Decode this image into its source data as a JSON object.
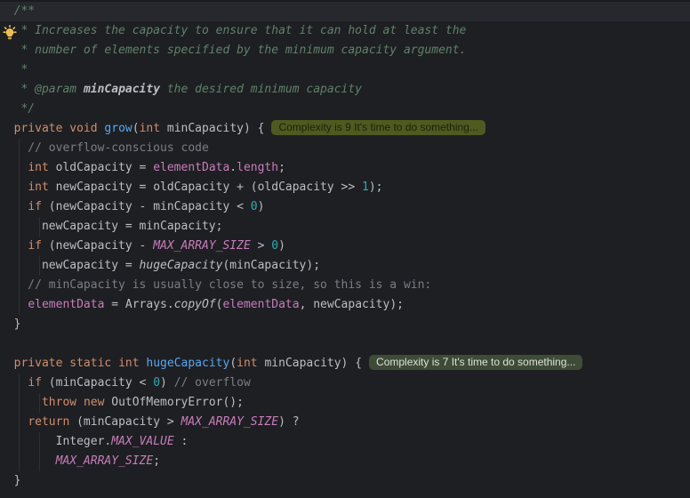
{
  "app": {
    "kind": "code-editor",
    "language": "java",
    "background": "#1e1f22",
    "caret_line_color": "#26282e",
    "indent_guide_color": "#2e3035"
  },
  "syntax_colors": {
    "doc_comment": "#5f826b",
    "line_comment": "#7a7e85",
    "keyword": "#cf8e6d",
    "method_declaration": "#56a8f5",
    "static_call": "#bcbec4",
    "field": "#c77dbb",
    "static_constant": "#c77dbb",
    "number": "#2aacb8",
    "plain_text": "#bcbec4"
  },
  "icons": {
    "intention_bulb": "lightbulb-icon",
    "bulb_color": "#edc04d"
  },
  "hints": {
    "grow": {
      "label": "Complexity is 9 It's time to do something...",
      "bg": "#4e5a20",
      "fg": "#1a220a"
    },
    "hugeCapacity": {
      "label": "Complexity is 7 It's time to do something...",
      "bg": "#3e4b37",
      "fg": "#dce2d6"
    }
  },
  "code": {
    "lines": [
      {
        "caret": true,
        "segments": [
          [
            "doc",
            "  /**"
          ]
        ]
      },
      {
        "bulb": true,
        "segments": [
          [
            "doc",
            "   * Increases the capacity to ensure that it can hold at least the"
          ]
        ]
      },
      {
        "segments": [
          [
            "doc",
            "   * number of elements specified by the minimum capacity argument."
          ]
        ]
      },
      {
        "segments": [
          [
            "doc",
            "   *"
          ]
        ]
      },
      {
        "segments": [
          [
            "doc",
            "   * "
          ],
          [
            "doctag",
            "@param"
          ],
          [
            "doc",
            " "
          ],
          [
            "docparam",
            "minCapacity"
          ],
          [
            "doc",
            " the desired minimum capacity"
          ]
        ]
      },
      {
        "segments": [
          [
            "doc",
            "   */"
          ]
        ]
      },
      {
        "hint": "grow",
        "segments": [
          [
            "plain",
            "  "
          ],
          [
            "kw",
            "private"
          ],
          [
            "plain",
            " "
          ],
          [
            "kw",
            "void"
          ],
          [
            "plain",
            " "
          ],
          [
            "mdecl",
            "grow"
          ],
          [
            "plain",
            "("
          ],
          [
            "kw",
            "int"
          ],
          [
            "plain",
            " minCapacity) {"
          ]
        ]
      },
      {
        "segments": [
          [
            "comment",
            "    // overflow-conscious code"
          ]
        ]
      },
      {
        "segments": [
          [
            "plain",
            "    "
          ],
          [
            "kw",
            "int"
          ],
          [
            "plain",
            " oldCapacity = "
          ],
          [
            "field",
            "elementData"
          ],
          [
            "plain",
            "."
          ],
          [
            "field",
            "length"
          ],
          [
            "plain",
            ";"
          ]
        ]
      },
      {
        "segments": [
          [
            "plain",
            "    "
          ],
          [
            "kw",
            "int"
          ],
          [
            "plain",
            " newCapacity = oldCapacity + (oldCapacity >> "
          ],
          [
            "num",
            "1"
          ],
          [
            "plain",
            ");"
          ]
        ]
      },
      {
        "segments": [
          [
            "plain",
            "    "
          ],
          [
            "kw",
            "if"
          ],
          [
            "plain",
            " (newCapacity - minCapacity < "
          ],
          [
            "num",
            "0"
          ],
          [
            "plain",
            ")"
          ]
        ]
      },
      {
        "segments": [
          [
            "plain",
            "      newCapacity = minCapacity;"
          ]
        ]
      },
      {
        "segments": [
          [
            "plain",
            "    "
          ],
          [
            "kw",
            "if"
          ],
          [
            "plain",
            " (newCapacity - "
          ],
          [
            "const",
            "MAX_ARRAY_SIZE"
          ],
          [
            "plain",
            " > "
          ],
          [
            "num",
            "0"
          ],
          [
            "plain",
            ")"
          ]
        ]
      },
      {
        "segments": [
          [
            "plain",
            "      newCapacity = "
          ],
          [
            "call",
            "hugeCapacity"
          ],
          [
            "plain",
            "(minCapacity);"
          ]
        ]
      },
      {
        "segments": [
          [
            "comment",
            "    // minCapacity is usually close to size, so this is a win:"
          ]
        ]
      },
      {
        "segments": [
          [
            "plain",
            "    "
          ],
          [
            "field",
            "elementData"
          ],
          [
            "plain",
            " = Arrays."
          ],
          [
            "call",
            "copyOf"
          ],
          [
            "plain",
            "("
          ],
          [
            "field",
            "elementData"
          ],
          [
            "plain",
            ", newCapacity);"
          ]
        ]
      },
      {
        "segments": [
          [
            "plain",
            "  }"
          ]
        ]
      },
      {
        "segments": [
          [
            "plain",
            ""
          ]
        ]
      },
      {
        "hint": "hugeCapacity",
        "segments": [
          [
            "plain",
            "  "
          ],
          [
            "kw",
            "private"
          ],
          [
            "plain",
            " "
          ],
          [
            "kw",
            "static"
          ],
          [
            "plain",
            " "
          ],
          [
            "kw",
            "int"
          ],
          [
            "plain",
            " "
          ],
          [
            "mdecl",
            "hugeCapacity"
          ],
          [
            "plain",
            "("
          ],
          [
            "kw",
            "int"
          ],
          [
            "plain",
            " minCapacity) {"
          ]
        ]
      },
      {
        "segments": [
          [
            "plain",
            "    "
          ],
          [
            "kw",
            "if"
          ],
          [
            "plain",
            " (minCapacity < "
          ],
          [
            "num",
            "0"
          ],
          [
            "plain",
            ") "
          ],
          [
            "comment",
            "// overflow"
          ]
        ]
      },
      {
        "segments": [
          [
            "plain",
            "      "
          ],
          [
            "kw",
            "throw"
          ],
          [
            "plain",
            " "
          ],
          [
            "kw",
            "new"
          ],
          [
            "plain",
            " OutOfMemoryError();"
          ]
        ]
      },
      {
        "segments": [
          [
            "plain",
            "    "
          ],
          [
            "kw",
            "return"
          ],
          [
            "plain",
            " (minCapacity > "
          ],
          [
            "const",
            "MAX_ARRAY_SIZE"
          ],
          [
            "plain",
            ") ?"
          ]
        ]
      },
      {
        "segments": [
          [
            "plain",
            "        Integer."
          ],
          [
            "const",
            "MAX_VALUE"
          ],
          [
            "plain",
            " :"
          ]
        ]
      },
      {
        "segments": [
          [
            "plain",
            "        "
          ],
          [
            "const",
            "MAX_ARRAY_SIZE"
          ],
          [
            "plain",
            ";"
          ]
        ]
      },
      {
        "segments": [
          [
            "plain",
            "  }"
          ]
        ]
      }
    ]
  }
}
